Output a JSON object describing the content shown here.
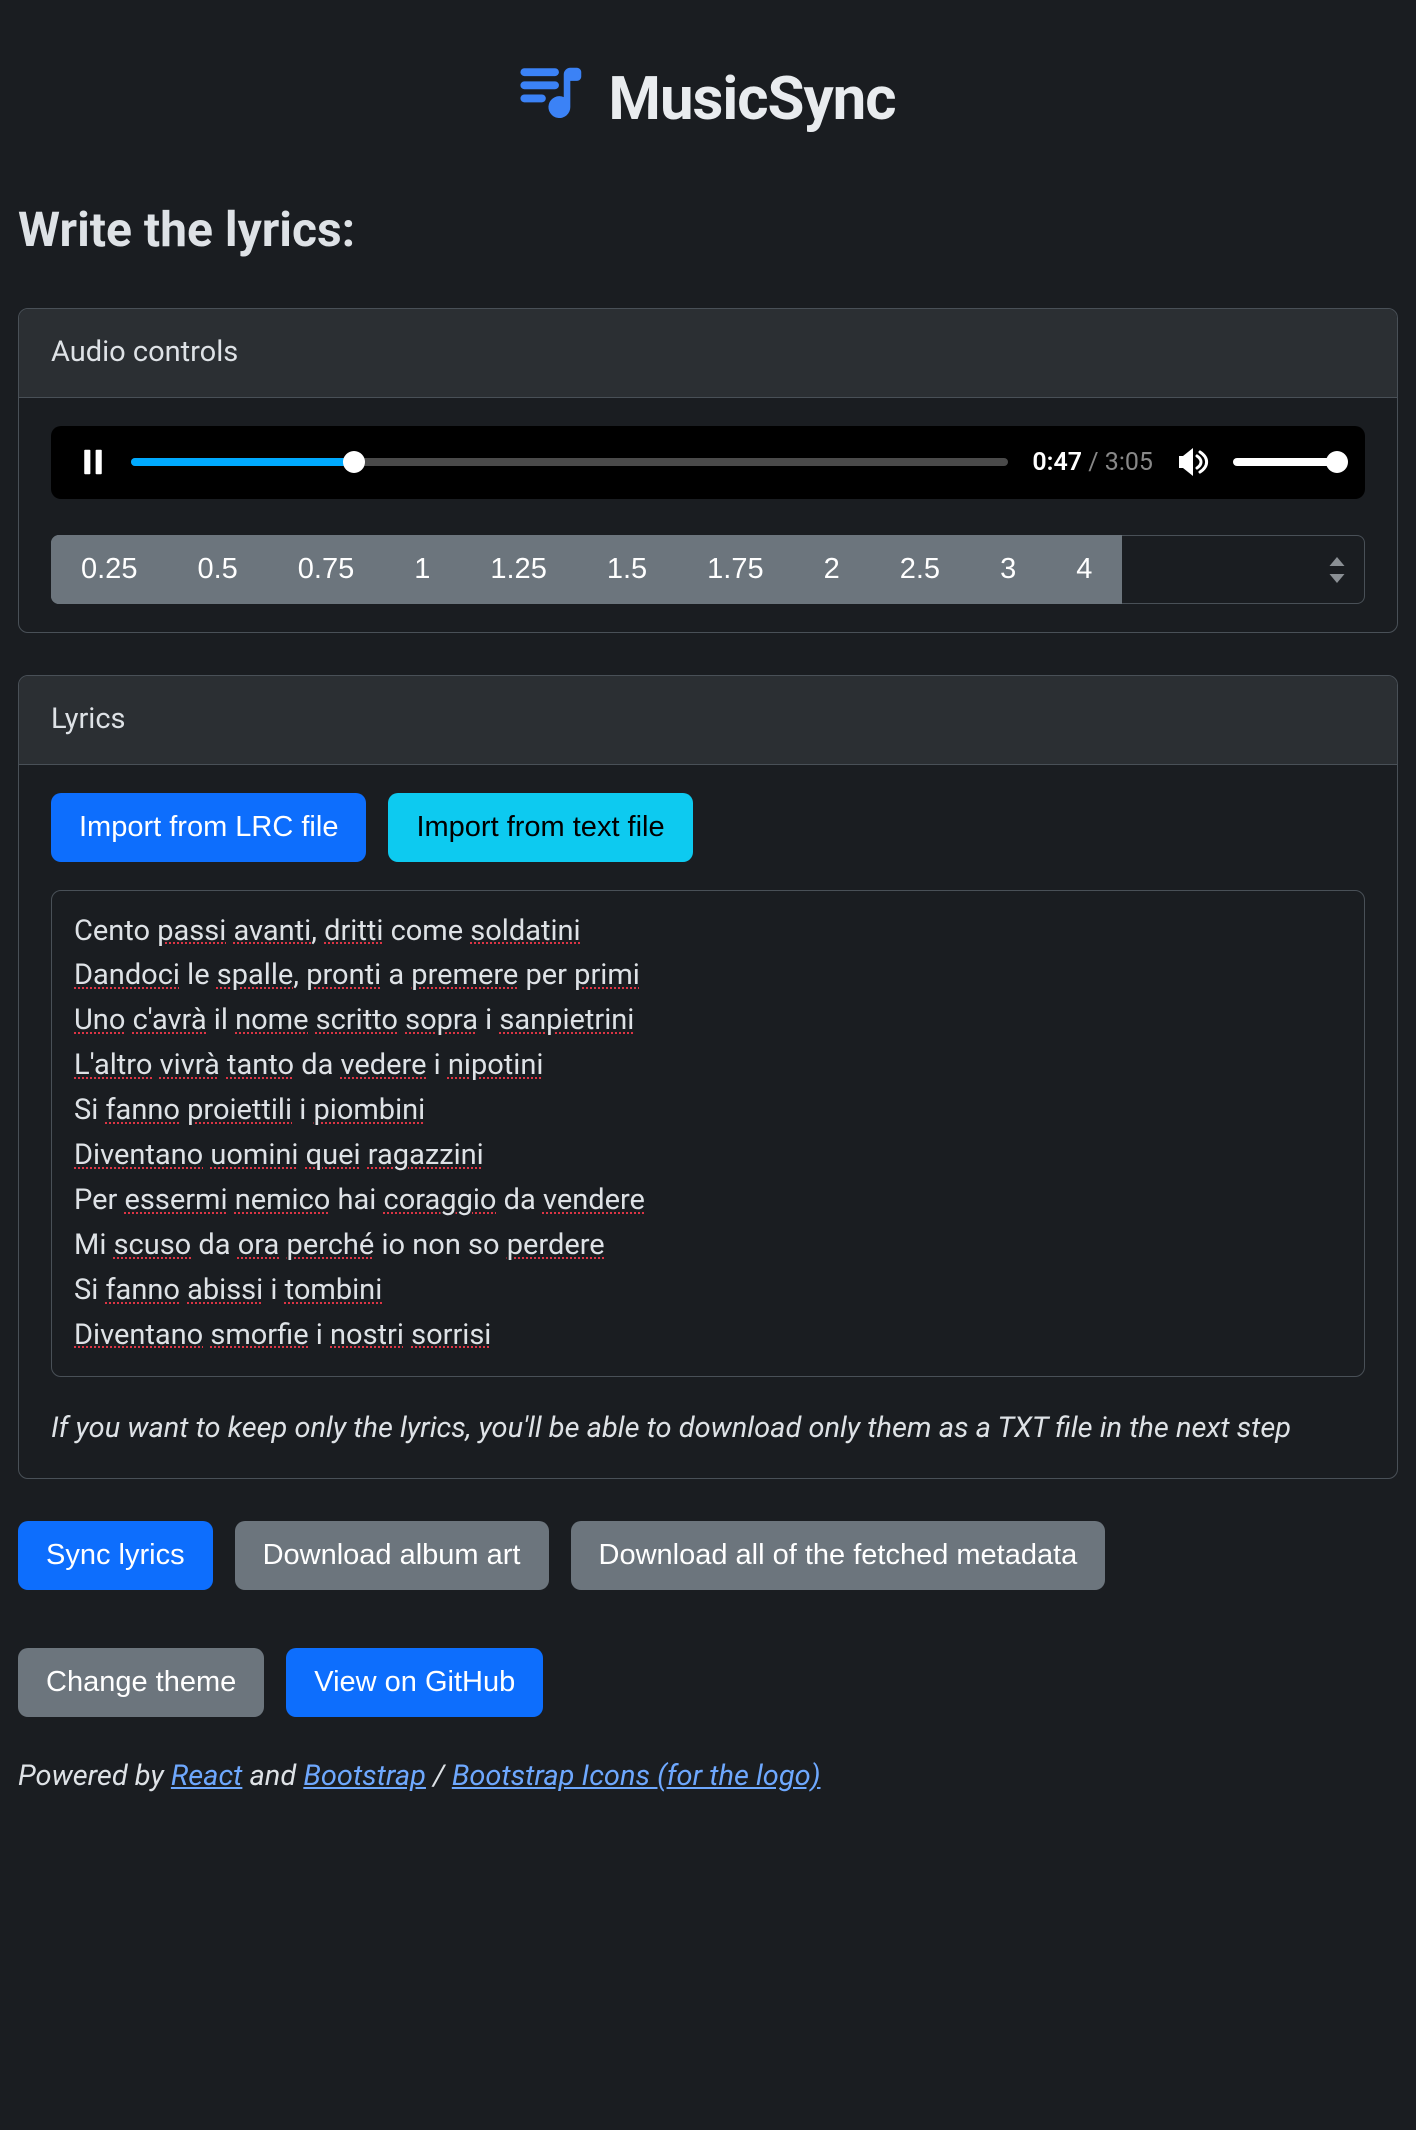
{
  "header": {
    "app_title": "MusicSync"
  },
  "section_title": "Write the lyrics:",
  "audio_card": {
    "header": "Audio controls",
    "current_time": "0:47",
    "total_time": "3:05",
    "speeds": [
      "0.25",
      "0.5",
      "0.75",
      "1",
      "1.25",
      "1.5",
      "1.75",
      "2",
      "2.5",
      "3",
      "4"
    ]
  },
  "lyrics_card": {
    "header": "Lyrics",
    "import_lrc": "Import from LRC file",
    "import_txt": "Import from text file",
    "lines": [
      "Cento passi avanti, dritti come soldatini",
      "Dandoci le spalle, pronti a premere per primi",
      "Uno c'avrà il nome scritto sopra i sanpietrini",
      "L'altro vivrà tanto da vedere i nipotini",
      "Si fanno proiettili i piombini",
      "Diventano uomini quei ragazzini",
      "Per essermi nemico hai coraggio da vendere",
      "Mi scuso da ora perché io non so perdere",
      "Si fanno abissi i tombini",
      "Diventano smorfie i nostri sorrisi"
    ],
    "help": "If you want to keep only the lyrics, you'll be able to download only them as a TXT file in the next step"
  },
  "actions": {
    "sync": "Sync lyrics",
    "download_art": "Download album art",
    "download_meta": "Download all of the fetched metadata"
  },
  "footer": {
    "change_theme": "Change theme",
    "github": "View on GitHub",
    "powered_prefix": "Powered by ",
    "react": "React",
    "and": " and ",
    "bootstrap": "Bootstrap",
    "slash": " / ",
    "bootstrap_icons": "Bootstrap Icons (for the logo)"
  }
}
